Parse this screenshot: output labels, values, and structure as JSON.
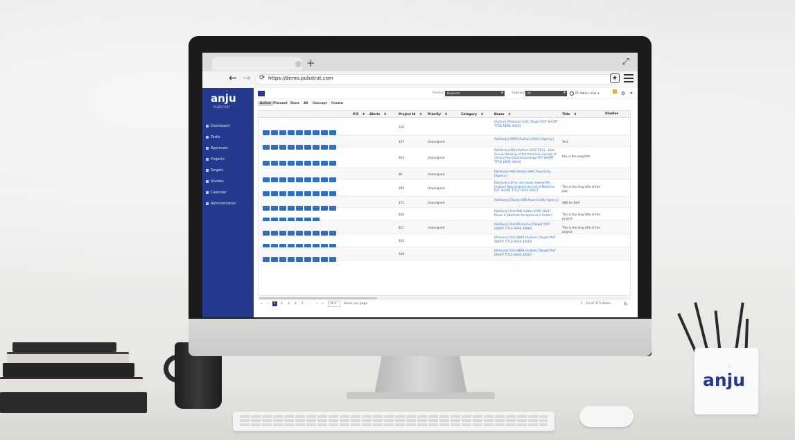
{
  "browser": {
    "url": "https://demo.pubstrat.com",
    "new_tab": "+"
  },
  "app": {
    "logo": "anju",
    "logo_sub": "PUBSTRAT",
    "sidebar": [
      {
        "label": "Dashboard"
      },
      {
        "label": "Tasks"
      },
      {
        "label": "Approvals"
      },
      {
        "label": "Projects"
      },
      {
        "label": "Targets"
      },
      {
        "label": "Studies"
      },
      {
        "label": "Calendar"
      },
      {
        "label": "Administration"
      }
    ],
    "topbar": {
      "product_label": "Product",
      "product_value": "Mujasant",
      "segment_label": "Segment",
      "segment_value": "All",
      "user": "PC Admin User",
      "notif_count": "1"
    },
    "subtabs": [
      "Active",
      "Planned",
      "Done",
      "All",
      "Concept",
      "Create"
    ],
    "columns": [
      "P/S",
      "Alerts",
      "Project Id",
      "Priority",
      "Category",
      "Name",
      "Title",
      "Studies"
    ],
    "rows": [
      {
        "id": "220",
        "priority": "",
        "name": "[Author].[Protocol].[US].[Target].PUT SHORT TITLE HERE 40412",
        "title": ""
      },
      {
        "id": "157",
        "priority": "Unassigned",
        "name": "[NoStudy].ABRR.[Author].ADAA.[Agency]",
        "title": "Test"
      },
      {
        "id": "823",
        "priority": "Unassigned",
        "name": "[NoStudy].ABS.[Author].ASCP 2021 - 61st Annual Meeting of the American Society of Clinical Psychopharmacology PUT SHORT TITLE HERE 40419",
        "title": "this is the long title"
      },
      {
        "id": "86",
        "priority": "Unassigned",
        "name": "[NoStudy].ABS.Shelton.BMC Psychiatry.[Agency]",
        "title": ""
      },
      {
        "id": "250",
        "priority": "Unassigned",
        "name": "[NoStudy].ID for non-study related.MS.[Author].New England Journal of Medicine PUT SHORT TITLE HERE 40427",
        "title": "This is the long title of the pub"
      },
      {
        "id": "171",
        "priority": "Unassigned",
        "name": "[NoStudy].[Study].ABS.Poarch.EHA.[Agency]",
        "title": "ABS for EHA"
      },
      {
        "id": "826",
        "priority": "",
        "name": "[NoStudy].Test.ABS.Author.SOPA 2021?Phase II [Abstract Accepted as a Poster]",
        "title": "This is the long title of the project"
      },
      {
        "id": "827",
        "priority": "Unassigned",
        "name": "[NoStudy].Test.MS.Author.[Target] PUT SHORT TITLE HERE 40883",
        "title": "This is the long title of the project"
      },
      {
        "id": "324",
        "priority": "",
        "name": "[Protocol].[US].ABRR.[Author].[Target].PUT SHORT TITLE HERE 40565",
        "title": ""
      },
      {
        "id": "328",
        "priority": "",
        "name": "[Protocol].[US].ABRR.[Author].[Target].PUT SHORT TITLE HERE 40567",
        "title": ""
      }
    ],
    "pager": {
      "first": "«",
      "prev": "‹",
      "pages": [
        "1",
        "2",
        "3",
        "4",
        "5",
        "..."
      ],
      "next": "›",
      "last": "»",
      "per_page": "10",
      "per_page_label": "items per page",
      "summary": "1 - 10 of 373 items"
    },
    "colors": {
      "brand": "#233a8f",
      "action": "#2f6fc2"
    },
    "icons": [
      "reload-icon",
      "star-icon",
      "menu-icon",
      "gear-icon",
      "exit-icon",
      "refresh-icon"
    ]
  },
  "desk": {
    "cup_logo": "anju"
  }
}
